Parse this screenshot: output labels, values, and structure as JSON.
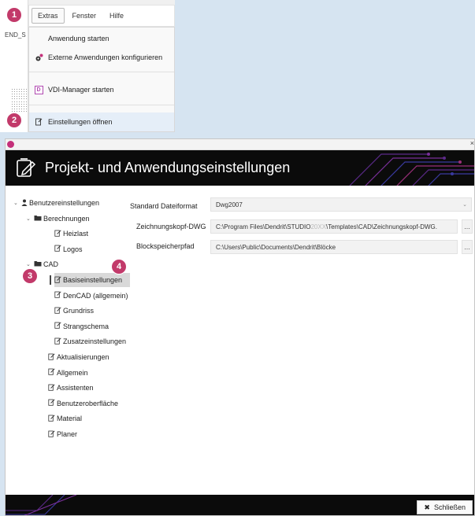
{
  "steps": [
    "1",
    "2",
    "3",
    "4"
  ],
  "background": {
    "column_text": "END_S"
  },
  "menubar": {
    "tabs": [
      "Extras",
      "Fenster",
      "Hilfe"
    ]
  },
  "dropdown": {
    "items": [
      {
        "label": "Anwendung starten",
        "icon": ""
      },
      {
        "label": "Externe Anwendungen konfigurieren",
        "icon": "gear-dot-icon"
      },
      {
        "label": "VDI-Manager starten",
        "icon": "vdi-icon",
        "icon_text": "D"
      },
      {
        "label": "Einstellungen öffnen",
        "icon": "settings-doc-icon"
      }
    ]
  },
  "window": {
    "title": "Projekt- und Anwendungseinstellungen",
    "close_glyph": "×",
    "accent": "#c23a6a"
  },
  "tree": {
    "nodes": [
      {
        "label": "Benutzereinstellungen",
        "icon": "user-icon",
        "toggle": "⌄"
      },
      {
        "label": "Berechnungen",
        "icon": "folder-icon",
        "toggle": "⌄"
      },
      {
        "label": "Heizlast",
        "icon": "settings-doc-icon"
      },
      {
        "label": "Logos",
        "icon": "settings-doc-icon"
      },
      {
        "label": "CAD",
        "icon": "folder-icon",
        "toggle": "⌄"
      },
      {
        "label": "Basiseinstellungen",
        "icon": "settings-doc-icon",
        "selected": true
      },
      {
        "label": "DenCAD (allgemein)",
        "icon": "settings-doc-icon"
      },
      {
        "label": "Grundriss",
        "icon": "settings-doc-icon"
      },
      {
        "label": "Strangschema",
        "icon": "settings-doc-icon"
      },
      {
        "label": "Zusatzeinstellungen",
        "icon": "settings-doc-icon"
      },
      {
        "label": "Aktualisierungen",
        "icon": "settings-doc-icon"
      },
      {
        "label": "Allgemein",
        "icon": "settings-doc-icon"
      },
      {
        "label": "Assistenten",
        "icon": "settings-doc-icon"
      },
      {
        "label": "Benutzeroberfläche",
        "icon": "settings-doc-icon"
      },
      {
        "label": "Material",
        "icon": "settings-doc-icon"
      },
      {
        "label": "Planer",
        "icon": "settings-doc-icon"
      }
    ]
  },
  "settings": {
    "format_label": "Standard Dateiformat",
    "format_value": "Dwg2007",
    "header_label": "Zeichnungskopf-DWG",
    "header_value_pre": "C:\\Program Files\\Dendrit\\STUDIO",
    "header_value_dim": "20XX",
    "header_value_post": "\\Templates\\CAD\\Zeichnungskopf-DWG.",
    "block_label": "Blockspeicherpfad",
    "block_value": "C:\\Users\\Public\\Documents\\Dendrit\\Blöcke",
    "dots": "..."
  },
  "footer": {
    "close_label": "Schließen",
    "close_glyph": "✖"
  }
}
